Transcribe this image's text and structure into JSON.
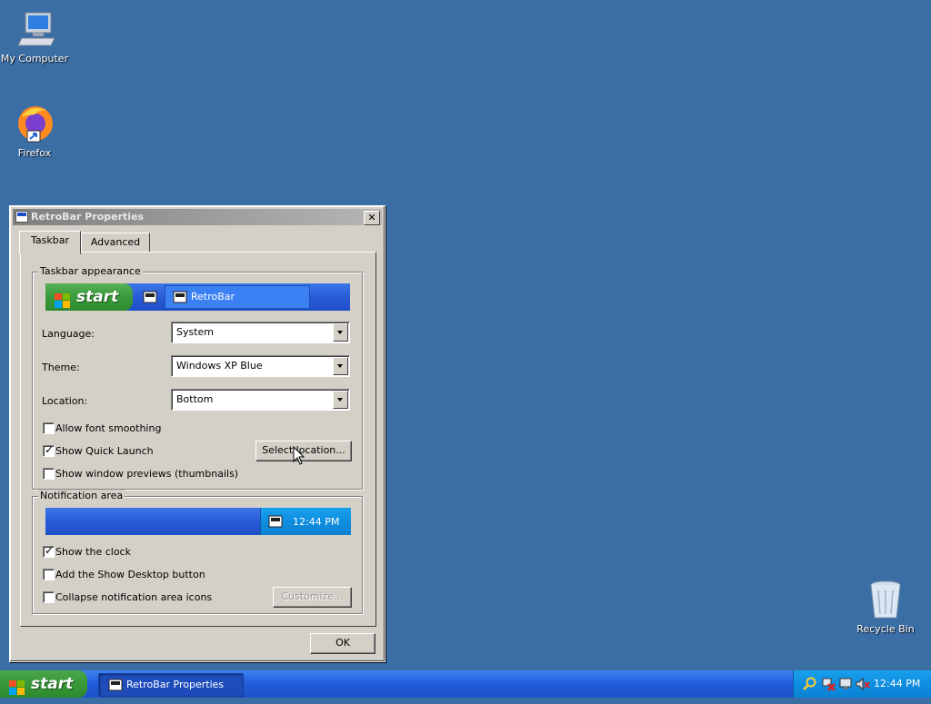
{
  "desktop": {
    "icons": [
      {
        "label": "My Computer",
        "icon": "computer-icon"
      },
      {
        "label": "Firefox",
        "icon": "firefox-icon"
      },
      {
        "label": "Recycle Bin",
        "icon": "recycle-bin-icon"
      }
    ]
  },
  "window": {
    "title": "RetroBar Properties",
    "close_label": "✕",
    "tabs": [
      {
        "label": "Taskbar",
        "active": true
      },
      {
        "label": "Advanced",
        "active": false
      }
    ],
    "appearance": {
      "group_label": "Taskbar appearance",
      "preview_start_label": "start",
      "preview_task_label": "RetroBar"
    },
    "language": {
      "label": "Language:",
      "value": "System"
    },
    "theme": {
      "label": "Theme:",
      "value": "Windows XP Blue"
    },
    "location": {
      "label": "Location:",
      "value": "Bottom"
    },
    "checks": {
      "font_smoothing": {
        "label": "Allow font smoothing",
        "checked": false
      },
      "quick_launch": {
        "label": "Show Quick Launch",
        "checked": true
      },
      "window_previews": {
        "label": "Show window previews (thumbnails)",
        "checked": false
      }
    },
    "select_location_label": "Select location...",
    "notification": {
      "group_label": "Notification area",
      "preview_clock": "12:44 PM",
      "show_clock": {
        "label": "Show the clock",
        "checked": true
      },
      "show_desktop": {
        "label": "Add the Show Desktop button",
        "checked": false
      },
      "collapse_icons": {
        "label": "Collapse notification area icons",
        "checked": false
      },
      "customize_label": "Customize..."
    },
    "ok_label": "OK"
  },
  "taskbar": {
    "start_label": "start",
    "task_label": "RetroBar Properties",
    "clock": "12:44 PM",
    "tray_icons": [
      "search-icon",
      "network-error-icon",
      "monitor-icon",
      "volume-muted-icon"
    ]
  },
  "colors": {
    "desktop": "#3a6ea5",
    "taskbar": "#245edb",
    "tray": "#0f8ee0",
    "start": "#389838"
  }
}
